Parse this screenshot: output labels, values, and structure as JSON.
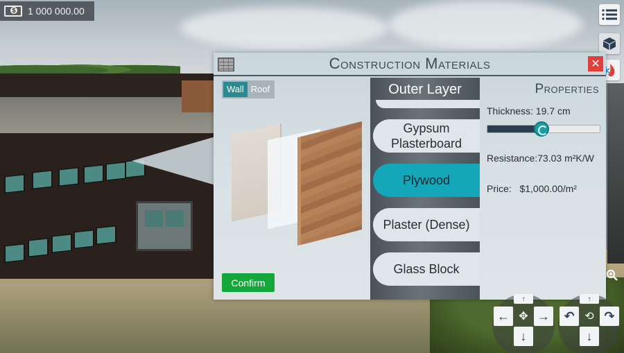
{
  "hud": {
    "money_icon": "money-bill-icon",
    "money_value": "1 000 000.00",
    "menu_icon": "list-menu-icon",
    "cube_icon": "cube-icon",
    "heat_icon": "heating-cooling-icon",
    "zoom_icon": "zoom-in-icon"
  },
  "dialog": {
    "title": "Construction Materials",
    "title_icon": "brick-wall-icon",
    "close_label": "✕",
    "tabs": [
      {
        "label": "Wall",
        "active": true
      },
      {
        "label": "Roof",
        "active": false
      }
    ],
    "confirm_label": "Confirm",
    "layer_header": "Outer Layer",
    "materials": [
      {
        "label": "Gypsum Plasterboard",
        "selected": false
      },
      {
        "label": "Plywood",
        "selected": true
      },
      {
        "label": "Plaster (Dense)",
        "selected": false
      },
      {
        "label": "Glass Block",
        "selected": false
      }
    ],
    "properties": {
      "title": "Properties",
      "thickness_label": "Thickness: 19.7 cm",
      "thickness_slider_fraction": 0.48,
      "resistance_label": "Resistance:73.03 m²K/W",
      "price_label": "Price:   $1,000.00/m²"
    }
  },
  "camera_controls": {
    "move": {
      "left": "←",
      "right": "→",
      "down": "↓",
      "up": "↑",
      "center_icon": "pan-move-icon"
    },
    "rotate": {
      "left": "↶",
      "right": "↷",
      "down": "↓",
      "up": "↑",
      "center_icon": "orbit-rotate-icon"
    }
  },
  "colors": {
    "accent_teal": "#14a7ba",
    "confirm_green": "#14a83a",
    "close_red": "#e0403a",
    "tab_active": "#2a8a92",
    "slider_fill": "#2c3e52"
  }
}
